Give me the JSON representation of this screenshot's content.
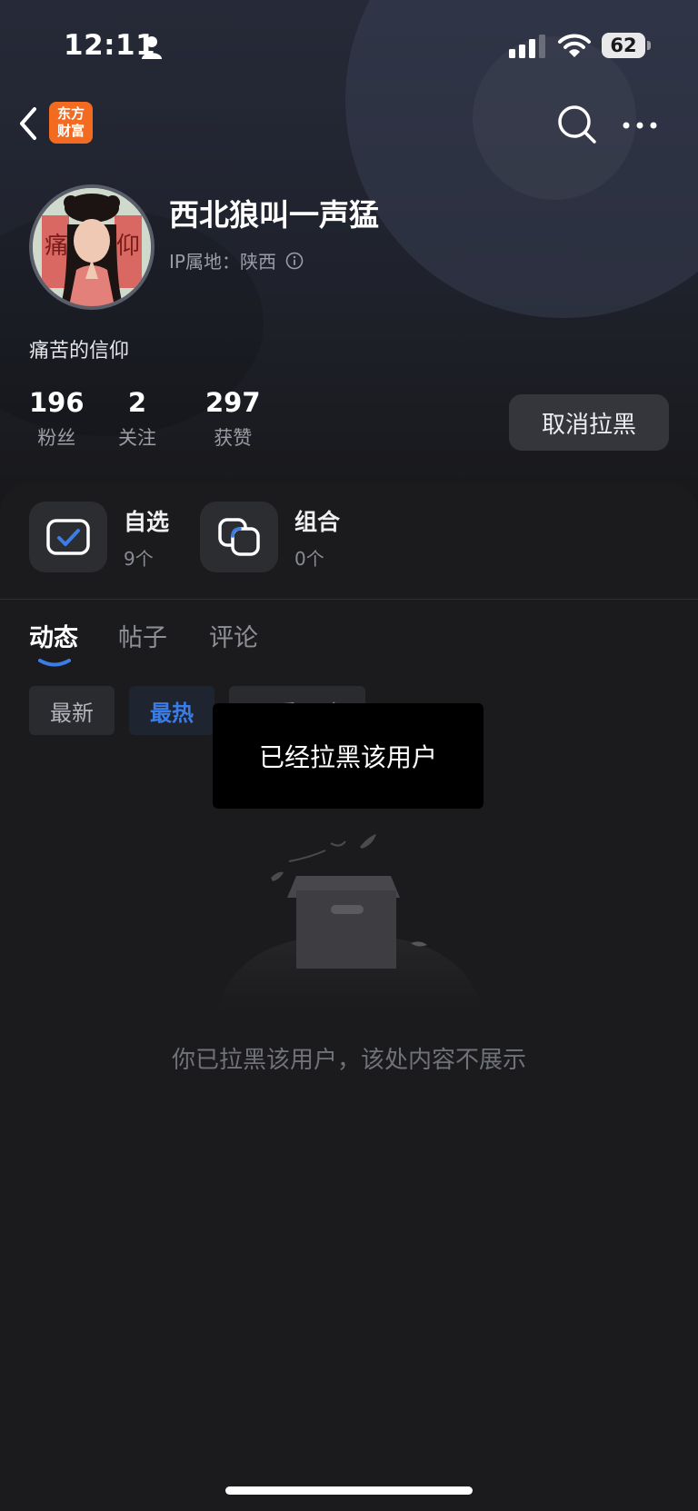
{
  "status_bar": {
    "time": "12:11",
    "battery": "62"
  },
  "nav": {
    "logo_text_top": "东方",
    "logo_text_bottom": "财富"
  },
  "profile": {
    "username": "西北狼叫一声猛",
    "ip_label": "IP属地：陕西",
    "bio": "痛苦的信仰",
    "avatar_text_left": "痛",
    "avatar_text_right": "仰"
  },
  "stats": [
    {
      "value": "196",
      "label": "粉丝"
    },
    {
      "value": "2",
      "label": "关注"
    },
    {
      "value": "297",
      "label": "获赞"
    }
  ],
  "unblock_button": "取消拉黑",
  "shortcuts": [
    {
      "title": "自选",
      "count": "9个"
    },
    {
      "title": "组合",
      "count": "0个"
    }
  ],
  "tabs": [
    "动态",
    "帖子",
    "评论"
  ],
  "chips": [
    "最新",
    "最热",
    "只看原贴"
  ],
  "toast": "已经拉黑该用户",
  "empty_message": "你已拉黑该用户，该处内容不展示",
  "colors": {
    "accent_blue": "#3b7de6",
    "logo_orange": "#f36b21"
  }
}
